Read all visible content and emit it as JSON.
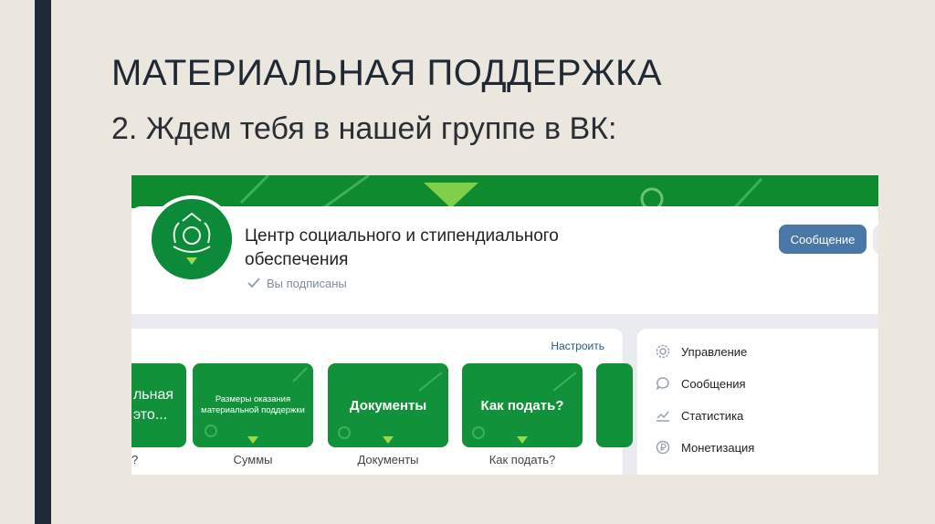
{
  "slide": {
    "title": "МАТЕРИАЛЬНАЯ ПОДДЕРЖКА",
    "subtitle": "2. Ждем тебя в нашей группе в ВК:"
  },
  "vk": {
    "group_name": "Центр социального и стипендиального обеспечения",
    "subscribed_label": "Вы подписаны",
    "message_button": "Сообщение",
    "widgets": {
      "configure_label": "Настроить",
      "tiles": [
        {
          "title_lines": [
            "льная",
            "это..."
          ],
          "caption": "о?"
        },
        {
          "title_lines": [
            "Размеры оказания",
            "материальной поддержки"
          ],
          "caption": "Суммы"
        },
        {
          "title_lines": [
            "Документы"
          ],
          "caption": "Документы"
        },
        {
          "title_lines": [
            "Как подать?"
          ],
          "caption": "Как подать?"
        }
      ]
    },
    "menu": [
      {
        "label": "Управление",
        "icon": "gear-icon"
      },
      {
        "label": "Сообщения",
        "icon": "chat-bubble-icon"
      },
      {
        "label": "Статистика",
        "icon": "trend-chart-icon"
      },
      {
        "label": "Монетизация",
        "icon": "ruble-coin-icon"
      }
    ],
    "colors": {
      "brand_green": "#11913a",
      "vk_blue": "#4a76a8"
    }
  }
}
